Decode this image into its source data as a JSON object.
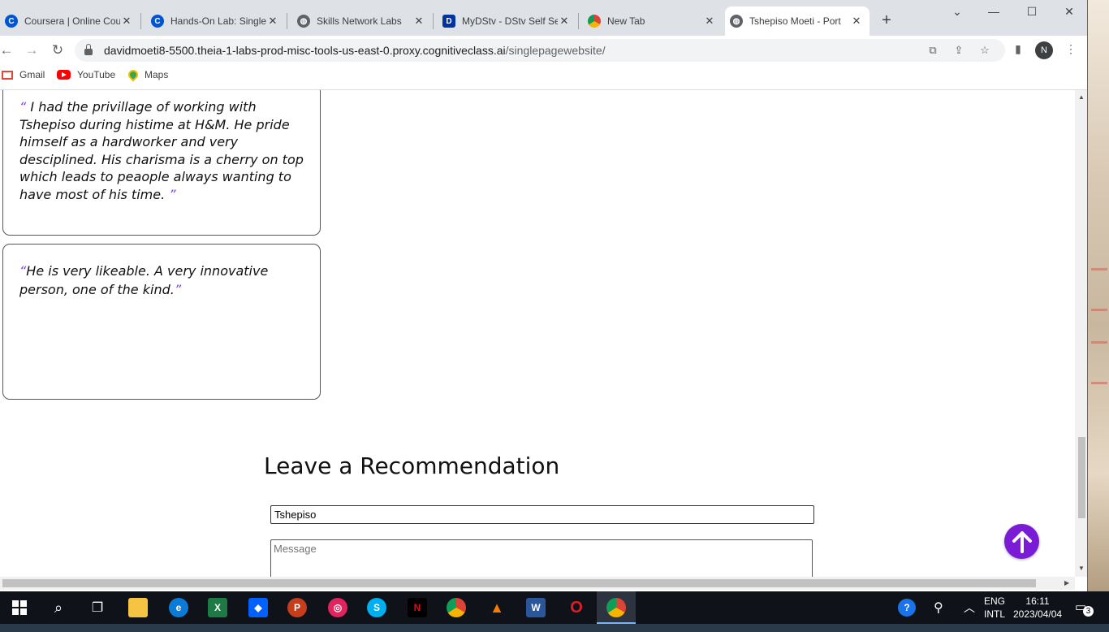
{
  "browser": {
    "tabs": [
      {
        "title": "Coursera | Online Cou",
        "favicon": "coursera-icon"
      },
      {
        "title": "Hands-On Lab: Single",
        "favicon": "coursera-icon"
      },
      {
        "title": "Skills Network Labs",
        "favicon": "globe-icon"
      },
      {
        "title": "MyDStv - DStv Self Se",
        "favicon": "dstv-icon"
      },
      {
        "title": "New Tab",
        "favicon": "chrome-icon"
      },
      {
        "title": "Tshepiso Moeti - Port",
        "favicon": "globe-icon",
        "active": true
      }
    ],
    "url_host": "davidmoeti8-5500.theia-1-labs-prod-misc-tools-us-east-0.proxy.cognitiveclass.ai",
    "url_path": "/singlepagewebsite/",
    "profile_initial": "N",
    "bookmarks": [
      {
        "label": "Gmail",
        "icon": "gmail-icon"
      },
      {
        "label": "YouTube",
        "icon": "youtube-icon"
      },
      {
        "label": "Maps",
        "icon": "maps-icon"
      }
    ]
  },
  "page": {
    "recommendations": [
      {
        "open_quote": "“",
        "text": " I had the privillage of working with Tshepiso during histime at H&M. He pride himself as a hardworker and very desciplined. His charisma is a cherry on top which leads to peaople always wanting to have most of his time. ",
        "close_quote": "”"
      },
      {
        "open_quote": "“",
        "text": "He is very likeable. A very innovative person, one of the kind.",
        "close_quote": "”"
      }
    ],
    "form_title": "Leave a Recommendation",
    "name_value": "Tshepiso",
    "message_placeholder": "Message",
    "accent_color": "#7a1cd6"
  },
  "taskbar": {
    "apps": [
      "start-icon",
      "search-icon",
      "task-view-icon",
      "file-explorer-icon",
      "edge-icon",
      "excel-icon",
      "dropbox-icon",
      "powerpoint-icon",
      "screen-recorder-icon",
      "skype-icon",
      "netflix-icon",
      "chrome-icon",
      "vlc-icon",
      "word-icon",
      "opera-icon",
      "chrome-profile-icon"
    ],
    "language_top": "ENG",
    "language_bottom": "INTL",
    "time": "16:11",
    "date": "2023/04/04",
    "notifications": "3"
  }
}
